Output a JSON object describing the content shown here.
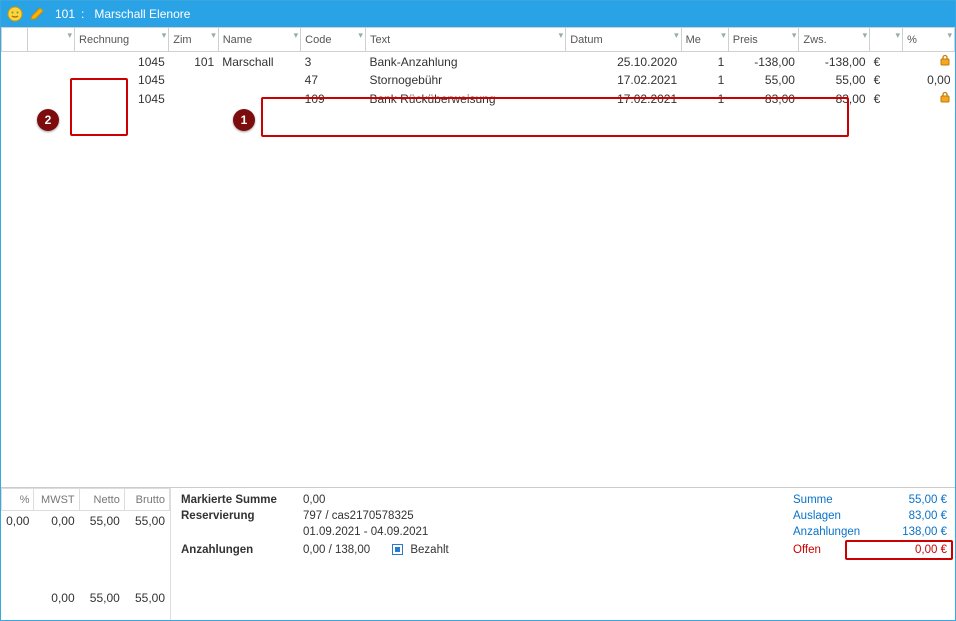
{
  "title": {
    "room": "101",
    "sep": ":",
    "guest": "Marschall Elenore"
  },
  "columns": {
    "c0": "",
    "c1": "",
    "rechnung": "Rechnung",
    "zim": "Zim",
    "name": "Name",
    "code": "Code",
    "text": "Text",
    "datum": "Datum",
    "me": "Me",
    "preis": "Preis",
    "zws": "Zws.",
    "cur": "",
    "pct": "%"
  },
  "rows": [
    {
      "rechnung": "1045",
      "zim": "101",
      "name": "Marschall",
      "code": "3",
      "text": "Bank-Anzahlung",
      "datum": "25.10.2020",
      "me": "1",
      "preis": "-138,00",
      "zws": "-138,00",
      "cur": "€",
      "pct": "",
      "locked": true
    },
    {
      "rechnung": "1045",
      "zim": "",
      "name": "",
      "code": "47",
      "text": "Stornogebühr",
      "datum": "17.02.2021",
      "me": "1",
      "preis": "55,00",
      "zws": "55,00",
      "cur": "€",
      "pct": "0,00",
      "locked": false
    },
    {
      "rechnung": "1045",
      "zim": "",
      "name": "",
      "code": "109",
      "text": "Bank Rücküberweisung",
      "datum": "17.02.2021",
      "me": "1",
      "preis": "83,00",
      "zws": "83,00",
      "cur": "€",
      "pct": "",
      "locked": true
    }
  ],
  "callouts": {
    "one": "1",
    "two": "2"
  },
  "footer_left": {
    "headers": {
      "pct": "%",
      "mwst": "MWST",
      "netto": "Netto",
      "brutto": "Brutto"
    },
    "rows": [
      {
        "pct": "0,00",
        "mwst": "0,00",
        "netto": "55,00",
        "brutto": "55,00"
      }
    ],
    "totals": {
      "mwst": "0,00",
      "netto": "55,00",
      "brutto": "55,00"
    }
  },
  "footer_mid": {
    "markierte_label": "Markierte Summe",
    "markierte_value": "0,00",
    "reservierung_label": "Reservierung",
    "reservierung_value": "797 / cas2170578325",
    "reservierung_dates": "01.09.2021  -  04.09.2021",
    "anzahlungen_label": "Anzahlungen",
    "anzahlungen_value": "0,00 / 138,00",
    "bezahlt_label": "Bezahlt"
  },
  "footer_right": {
    "summe_label": "Summe",
    "summe_value": "55,00  €",
    "auslagen_label": "Auslagen",
    "auslagen_value": "83,00  €",
    "anz_label": "Anzahlungen",
    "anz_value": "138,00  €",
    "offen_label": "Offen",
    "offen_value": "0,00  €"
  }
}
